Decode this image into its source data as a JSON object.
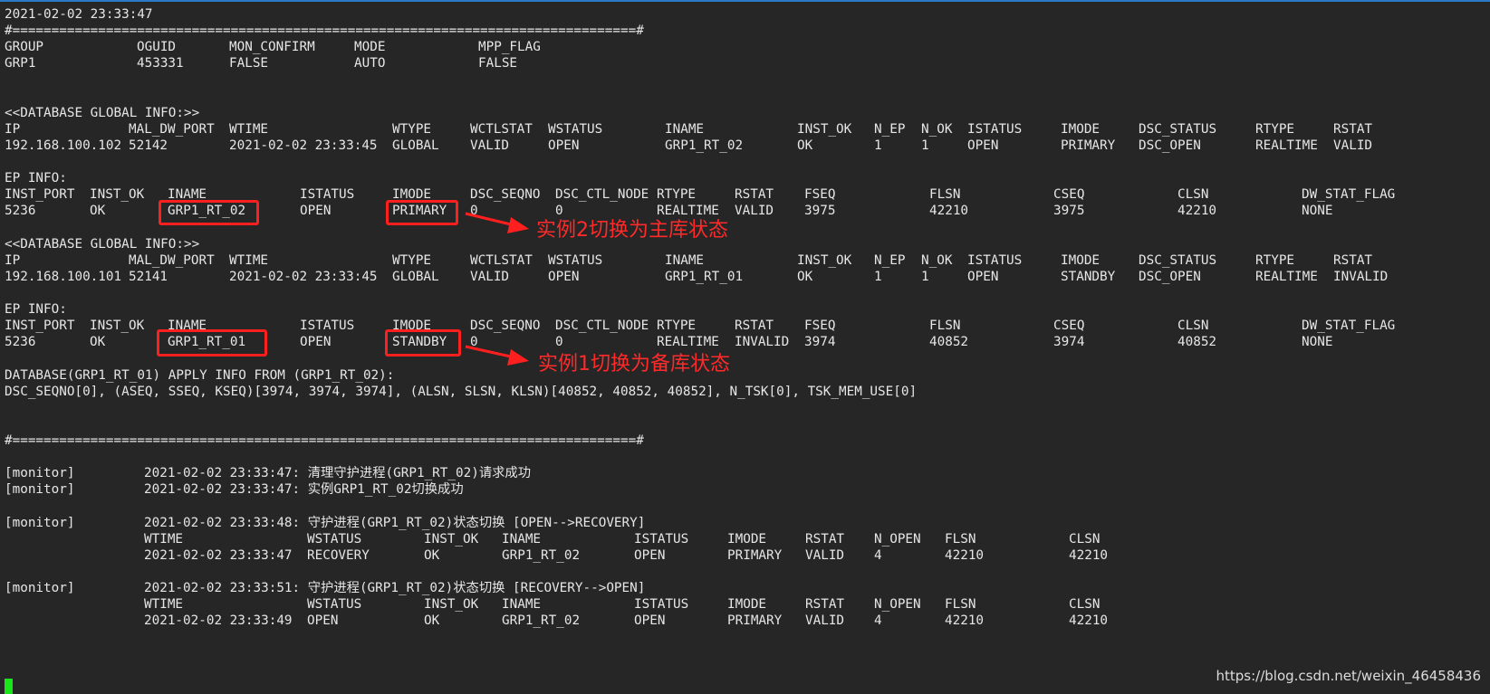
{
  "header": {
    "timestamp": "2021-02-02 23:33:47",
    "separator": "#================================================================================#"
  },
  "group": {
    "headers": [
      "GROUP",
      "OGUID",
      "MON_CONFIRM",
      "MODE",
      "MPP_FLAG"
    ],
    "values": [
      "GRP1",
      "453331",
      "FALSE",
      "AUTO",
      "FALSE"
    ]
  },
  "db1": {
    "title": "<<DATABASE GLOBAL INFO:>>",
    "headers": [
      "IP",
      "MAL_DW_PORT",
      "WTIME",
      "WTYPE",
      "WCTLSTAT",
      "WSTATUS",
      "INAME",
      "INST_OK",
      "N_EP",
      "N_OK",
      "ISTATUS",
      "IMODE",
      "DSC_STATUS",
      "RTYPE",
      "RSTAT"
    ],
    "values": [
      "192.168.100.102",
      "52142",
      "2021-02-02 23:33:45",
      "GLOBAL",
      "VALID",
      "OPEN",
      "GRP1_RT_02",
      "OK",
      "1",
      "1",
      "OPEN",
      "PRIMARY",
      "DSC_OPEN",
      "REALTIME",
      "VALID"
    ],
    "ep_title": "EP INFO:",
    "ep_headers": [
      "INST_PORT",
      "INST_OK",
      "INAME",
      "ISTATUS",
      "IMODE",
      "DSC_SEQNO",
      "DSC_CTL_NODE",
      "RTYPE",
      "RSTAT",
      "FSEQ",
      "FLSN",
      "CSEQ",
      "CLSN",
      "DW_STAT_FLAG"
    ],
    "ep_values": [
      "5236",
      "OK",
      "GRP1_RT_02",
      "OPEN",
      "PRIMARY",
      "0",
      "0",
      "REALTIME",
      "VALID",
      "3975",
      "42210",
      "3975",
      "42210",
      "NONE"
    ],
    "annotation": "实例2切换为主库状态"
  },
  "db2": {
    "title": "<<DATABASE GLOBAL INFO:>>",
    "headers": [
      "IP",
      "MAL_DW_PORT",
      "WTIME",
      "WTYPE",
      "WCTLSTAT",
      "WSTATUS",
      "INAME",
      "INST_OK",
      "N_EP",
      "N_OK",
      "ISTATUS",
      "IMODE",
      "DSC_STATUS",
      "RTYPE",
      "RSTAT"
    ],
    "values": [
      "192.168.100.101",
      "52141",
      "2021-02-02 23:33:45",
      "GLOBAL",
      "VALID",
      "OPEN",
      "GRP1_RT_01",
      "OK",
      "1",
      "1",
      "OPEN",
      "STANDBY",
      "DSC_OPEN",
      "REALTIME",
      "INVALID"
    ],
    "ep_title": "EP INFO:",
    "ep_headers": [
      "INST_PORT",
      "INST_OK",
      "INAME",
      "ISTATUS",
      "IMODE",
      "DSC_SEQNO",
      "DSC_CTL_NODE",
      "RTYPE",
      "RSTAT",
      "FSEQ",
      "FLSN",
      "CSEQ",
      "CLSN",
      "DW_STAT_FLAG"
    ],
    "ep_values": [
      "5236",
      "OK",
      "GRP1_RT_01",
      "OPEN",
      "STANDBY",
      "0",
      "0",
      "REALTIME",
      "INVALID",
      "3974",
      "40852",
      "3974",
      "40852",
      "NONE"
    ],
    "annotation": "实例1切换为备库状态"
  },
  "apply": {
    "line1": "DATABASE(GRP1_RT_01) APPLY INFO FROM (GRP1_RT_02):",
    "line2": "DSC_SEQNO[0], (ASEQ, SSEQ, KSEQ)[3974, 3974, 3974], (ALSN, SLSN, KLSN)[40852, 40852, 40852], N_TSK[0], TSK_MEM_USE[0]"
  },
  "monitor": {
    "tag": "[monitor]",
    "msg1": "2021-02-02 23:33:47: 清理守护进程(GRP1_RT_02)请求成功",
    "msg2": "2021-02-02 23:33:47: 实例GRP1_RT_02切换成功",
    "msg3": "2021-02-02 23:33:48: 守护进程(GRP1_RT_02)状态切换 [OPEN-->RECOVERY]",
    "msg4": "2021-02-02 23:33:51: 守护进程(GRP1_RT_02)状态切换 [RECOVERY-->OPEN]",
    "status_headers": [
      "WTIME",
      "WSTATUS",
      "INST_OK",
      "INAME",
      "ISTATUS",
      "IMODE",
      "RSTAT",
      "N_OPEN",
      "FLSN",
      "CLSN"
    ],
    "status1": [
      "2021-02-02 23:33:47",
      "RECOVERY",
      "OK",
      "GRP1_RT_02",
      "OPEN",
      "PRIMARY",
      "VALID",
      "4",
      "42210",
      "42210"
    ],
    "status2": [
      "2021-02-02 23:33:49",
      "OPEN",
      "OK",
      "GRP1_RT_02",
      "OPEN",
      "PRIMARY",
      "VALID",
      "4",
      "42210",
      "42210"
    ]
  },
  "watermark": "https://blog.csdn.net/weixin_46458436",
  "colors": {
    "background": "#262626",
    "text": "#e6e6e6",
    "highlight": "#ff1f1f",
    "cursor": "#19e619"
  }
}
